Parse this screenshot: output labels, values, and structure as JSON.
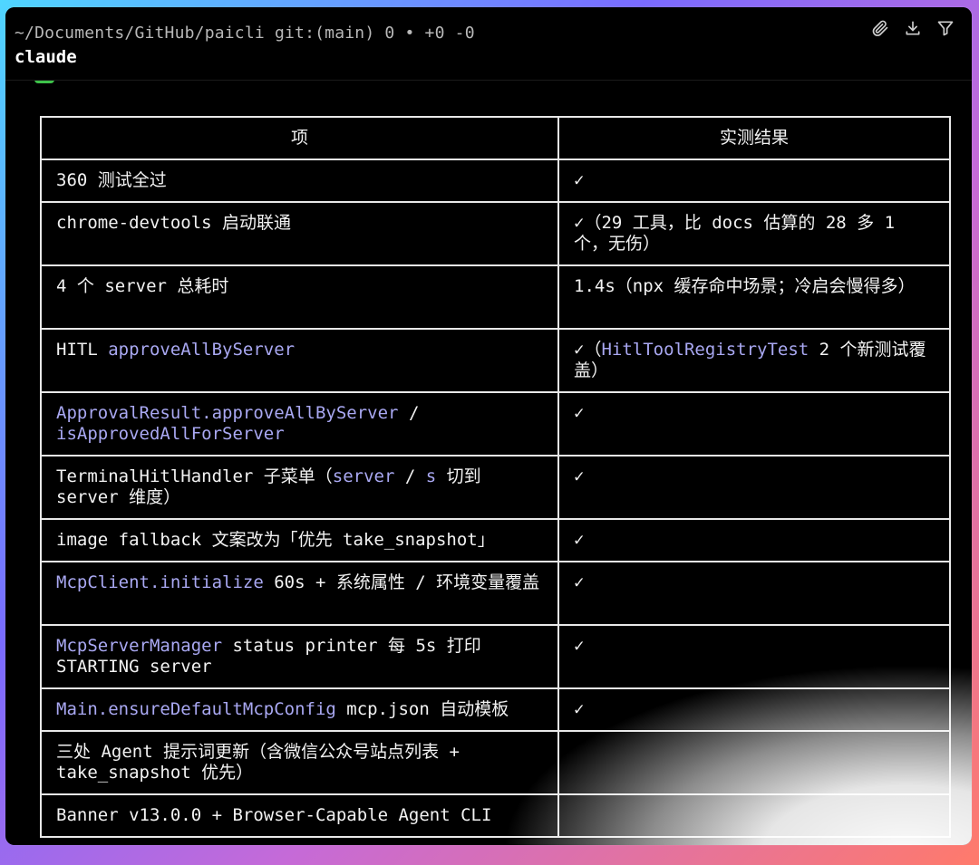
{
  "header": {
    "path": "~/Documents/GitHub/paicli",
    "git": "git:(main)",
    "status": "0 • +0 -0",
    "command": "claude"
  },
  "toolbar": {
    "icons": [
      "paperclip-icon",
      "download-icon",
      "filter-icon"
    ]
  },
  "table": {
    "headers": [
      "项",
      "实测结果"
    ],
    "rows": [
      {
        "item": [
          {
            "t": "360 测试全过"
          }
        ],
        "result": [
          {
            "t": "✓"
          }
        ]
      },
      {
        "item": [
          {
            "t": "chrome-devtools 启动联通"
          }
        ],
        "result": [
          {
            "t": "✓（29 工具，比 docs 估算的 28 多 1 个，无伤）"
          }
        ]
      },
      {
        "item": [
          {
            "t": "4 个 server 总耗时"
          }
        ],
        "result": [
          {
            "t": "1.4s（npx 缓存命中场景；冷启会慢得多）"
          }
        ]
      },
      {
        "item": [
          {
            "t": "HITL "
          },
          {
            "t": "approveAllByServer",
            "c": 1
          }
        ],
        "result": [
          {
            "t": "✓（"
          },
          {
            "t": "HitlToolRegistryTest",
            "c": 1
          },
          {
            "t": " 2 个新测试覆盖）"
          }
        ]
      },
      {
        "item": [
          {
            "t": "ApprovalResult.approveAllByServer",
            "c": 1
          },
          {
            "t": " / "
          },
          {
            "t": "isApprovedAllForServer",
            "c": 1
          }
        ],
        "result": [
          {
            "t": "✓"
          }
        ]
      },
      {
        "item": [
          {
            "t": "TerminalHitlHandler 子菜单（"
          },
          {
            "t": "server",
            "c": 1
          },
          {
            "t": " / "
          },
          {
            "t": "s",
            "c": 1
          },
          {
            "t": " 切到 server 维度）"
          }
        ],
        "result": [
          {
            "t": "✓"
          }
        ]
      },
      {
        "item": [
          {
            "t": "image fallback 文案改为「优先 take_snapshot」"
          }
        ],
        "result": [
          {
            "t": "✓"
          }
        ]
      },
      {
        "item": [
          {
            "t": "McpClient.initialize",
            "c": 1
          },
          {
            "t": " 60s + 系统属性 / 环境变量覆盖"
          }
        ],
        "result": [
          {
            "t": "✓"
          }
        ]
      },
      {
        "item": [
          {
            "t": "McpServerManager",
            "c": 1
          },
          {
            "t": " status printer 每 5s 打印 STARTING server"
          }
        ],
        "result": [
          {
            "t": "✓"
          }
        ]
      },
      {
        "item": [
          {
            "t": "Main.ensureDefaultMcpConfig",
            "c": 1
          },
          {
            "t": " mcp.json 自动模板"
          }
        ],
        "result": [
          {
            "t": "✓"
          }
        ]
      },
      {
        "item": [
          {
            "t": "三处 Agent 提示词更新（含微信公众号站点列表 + take_snapshot 优先）"
          }
        ],
        "result": []
      },
      {
        "item": [
          {
            "t": "Banner v13.0.0 + Browser-Capable Agent CLI"
          }
        ],
        "result": []
      }
    ]
  },
  "colors": {
    "code": "#a9a8f2",
    "text": "#f2f2f2",
    "border": "#e8e8e8",
    "background": "#000000"
  }
}
